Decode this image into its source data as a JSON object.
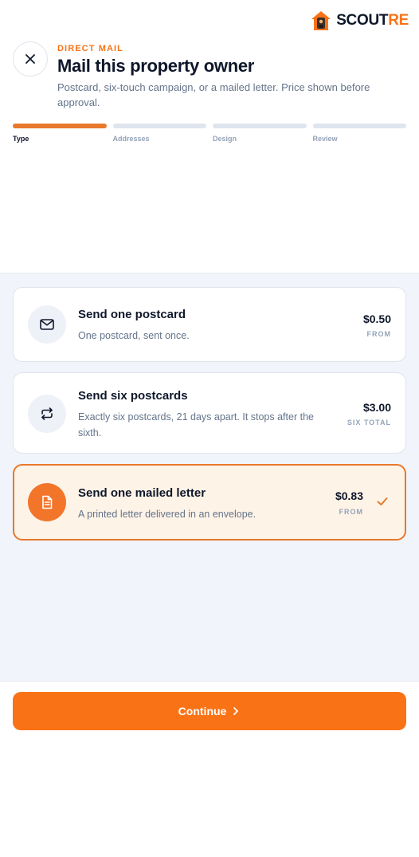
{
  "brand": {
    "name_part1": "SCOUT",
    "name_part2": "RE",
    "icon": "house-logo-icon"
  },
  "header": {
    "close_icon": "close-icon",
    "eyebrow": "DIRECT MAIL",
    "title": "Mail this property owner",
    "subtitle": "Postcard, six-touch campaign, or a mailed letter. Price shown before approval."
  },
  "steps": [
    {
      "label": "Type",
      "active": true
    },
    {
      "label": "Addresses",
      "active": false
    },
    {
      "label": "Design",
      "active": false
    },
    {
      "label": "Review",
      "active": false
    }
  ],
  "options": [
    {
      "title": "Send one postcard",
      "description": "One postcard, sent once.",
      "price": "$0.50",
      "price_label": "FROM",
      "icon": "envelope-icon",
      "selected": false
    },
    {
      "title": "Send six postcards",
      "description": "Exactly six postcards, 21 days apart. It stops after the sixth.",
      "price": "$3.00",
      "price_label": "SIX TOTAL",
      "icon": "repeat-icon",
      "selected": false
    },
    {
      "title": "Send one mailed letter",
      "description": "A printed letter delivered in an envelope.",
      "price": "$0.83",
      "price_label": "FROM",
      "icon": "document-icon",
      "selected": true
    }
  ],
  "footer": {
    "continue_label": "Continue",
    "icon": "chevron-right-icon"
  },
  "colors": {
    "accent": "#f97316",
    "text": "#0f172a",
    "muted": "#64748b",
    "bg": "#f1f4fa"
  }
}
